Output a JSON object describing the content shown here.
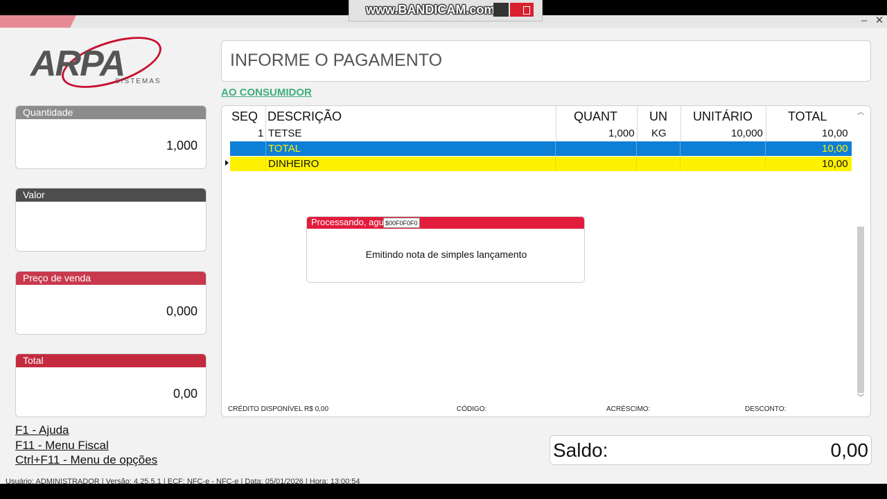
{
  "window": {
    "minimize": "–",
    "close": "✕"
  },
  "recorder": {
    "watermark": "www.BANDICAM.com"
  },
  "logo": {
    "brand": "ARPA",
    "tagline": "SISTEMAS"
  },
  "side": {
    "quantidade": {
      "label": "Quantidade",
      "value": "1,000"
    },
    "valor": {
      "label": "Valor",
      "value": ""
    },
    "preco": {
      "label": "Preço de venda",
      "value": "0,000"
    },
    "total": {
      "label": "Total",
      "value": "0,00"
    }
  },
  "shortcuts": [
    "F1 - Ajuda",
    "F11 - Menu Fiscal",
    "Ctrl+F11 - Menu de opções"
  ],
  "header": {
    "title": "INFORME O PAGAMENTO",
    "customer": "AO CONSUMIDOR"
  },
  "grid": {
    "columns": [
      "SEQ",
      "DESCRIÇÃO",
      "QUANT",
      "UN",
      "UNITÁRIO",
      "TOTAL"
    ],
    "item": {
      "seq": "1",
      "desc": "TETSE",
      "quant": "1,000",
      "un": "KG",
      "unit": "10,000",
      "total": "10,00"
    },
    "total_row": {
      "label": "TOTAL",
      "value": "10,00"
    },
    "payment_row": {
      "label": "DINHEIRO",
      "value": "10,00"
    },
    "footer": {
      "credito": "CRÉDITO DISPONÍVEL R$ 0,00",
      "codigo": "CÓDIGO:",
      "acrescimo": "ACRÉSCIMO:",
      "desconto": "DESCONTO:"
    }
  },
  "dialog": {
    "title": "Processando, agu",
    "tooltip": "$00F0F0F0",
    "message": "Emitindo nota de simples lançamento"
  },
  "saldo": {
    "label": "Saldo:",
    "value": "0,00"
  },
  "status": "Usuário: ADMINISTRADOR | Versão: 4.25.5.1 | ECF: NFC-e - NFC-e | Data: 05/01/2026 | Hora: 13:00:54",
  "colors": {
    "accent_red": "#c8394d",
    "grid_blue": "#0e7fd6",
    "grid_yellow": "#fff200",
    "link_green": "#3fae7c"
  }
}
